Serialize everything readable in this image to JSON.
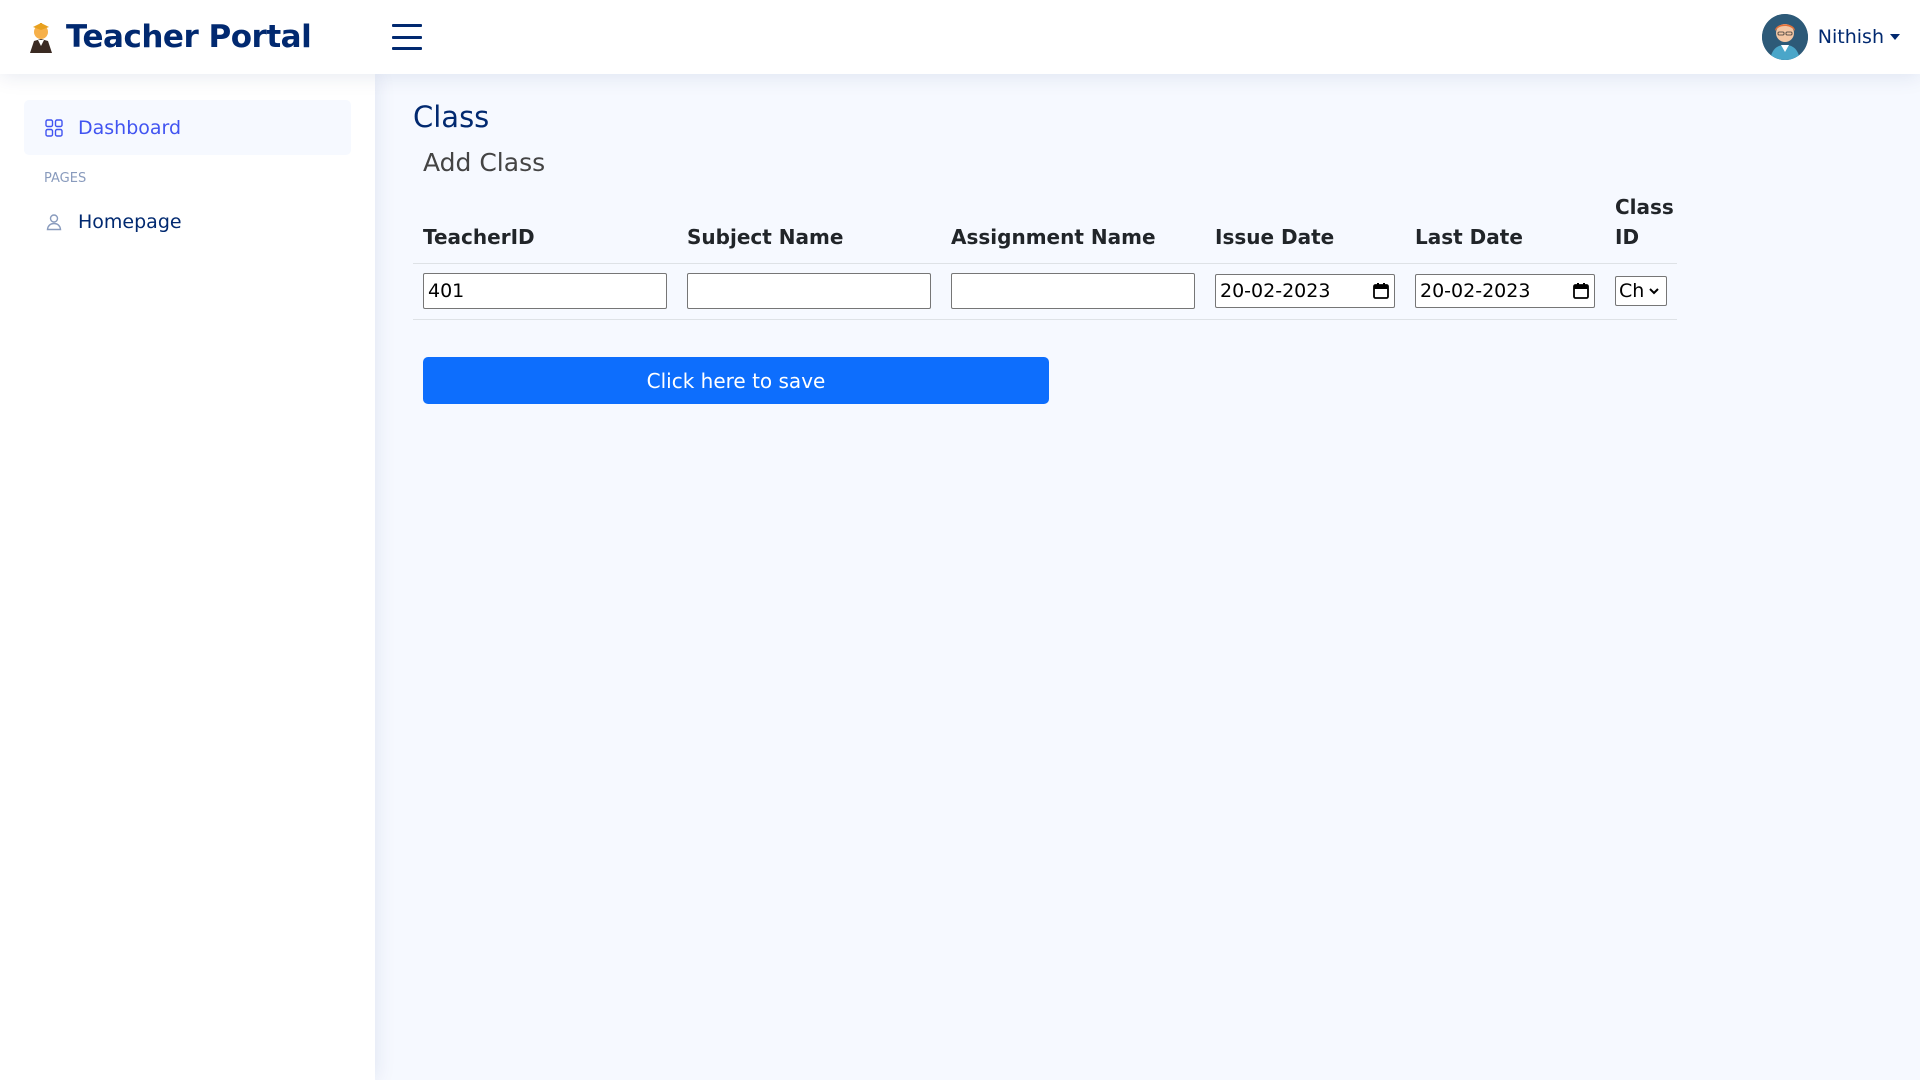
{
  "header": {
    "app_title": "Teacher Portal",
    "user_name": "Nithish",
    "icons": [
      "teacher-logo-icon",
      "hamburger-menu-icon",
      "user-avatar-icon",
      "caret-down-icon"
    ]
  },
  "sidebar": {
    "items": [
      {
        "label": "Dashboard",
        "icon": "grid-icon",
        "active": true
      },
      {
        "label": "Homepage",
        "icon": "person-icon",
        "active": false
      }
    ],
    "heading": "PAGES"
  },
  "main": {
    "page_title": "Class",
    "card_title": "Add Class",
    "columns": [
      "TeacherID",
      "Subject Name",
      "Assignment Name",
      "Issue Date",
      "Last Date",
      "Class ID"
    ],
    "fields": {
      "teacher_id": "401",
      "subject_name": "",
      "assignment_name": "",
      "issue_date": "20-02-2023",
      "last_date": "20-02-2023",
      "class_id": "Ch"
    },
    "save_label": "Click here to save"
  },
  "colors": {
    "brand": "#012970",
    "accent": "#4154f1",
    "button": "#0d6efd",
    "background": "#f6f9ff"
  }
}
